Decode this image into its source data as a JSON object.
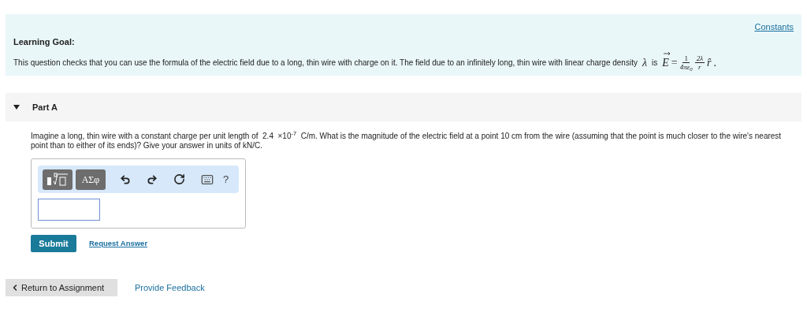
{
  "constants_link": "Constants",
  "learning_goal": {
    "title": "Learning Goal:",
    "text": "This question checks that you can use the formula of the electric field due to a long, thin wire with charge on it. The field due to an infinitely long, thin wire with linear charge density",
    "symbol": "λ",
    "connector": "is",
    "formula": {
      "lhs": "E",
      "equals": "=",
      "frac1_num": "1",
      "frac1_den": "4πε$_{0}$",
      "frac2_num": "2λ",
      "frac2_den": "r",
      "unit_vector": "r̂",
      "end": "."
    }
  },
  "part": {
    "title": "Part A",
    "expanded": true,
    "question": "Imagine a long, thin wire with a constant charge per unit length of  2.4  ×10$^{-7}$  C/m. What is the magnitude of the electric field at a point 10 cm from the wire (assuming that the point is much closer to the wire's nearest point than to either of its ends)? Give your answer in units of kN/C.",
    "toolbar": {
      "greek": "ΑΣφ",
      "help": "?"
    },
    "submit": "Submit",
    "request": "Request Answer"
  },
  "footer": {
    "return": "Return to Assignment",
    "feedback": "Provide Feedback"
  }
}
